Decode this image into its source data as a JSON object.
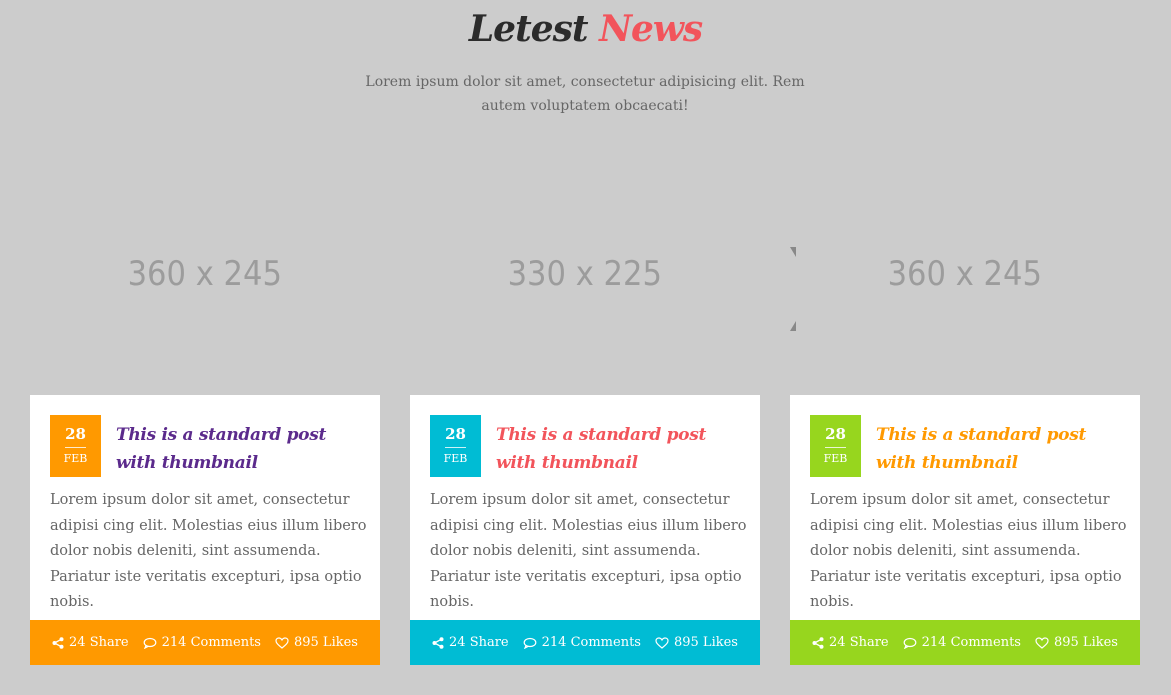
{
  "section": {
    "title_part1": "Letest",
    "title_part2": "News",
    "subtitle": "Lorem ipsum dolor sit amet, consectetur adipisicing elit. Rem autem voluptatem obcaecati!"
  },
  "colors": {
    "background": "#cccccc",
    "title_accent": "#f2545b",
    "card1_accent": "#ff9900",
    "card1_title": "#5b2a8c",
    "card2_accent": "#00bcd4",
    "card2_title": "#f2545b",
    "card3_accent": "#97d61e",
    "card3_title": "#ff9900"
  },
  "icons": {
    "share": "share-icon",
    "comments": "comment-icon",
    "likes": "heart-icon"
  },
  "posts": [
    {
      "thumbnail_label": "360 x 245",
      "day": "28",
      "month": "FEB",
      "title": "This is a standard post with thumbnail",
      "excerpt": "Lorem ipsum dolor sit amet, consectetur adipisi cing elit. Molestias eius illum libero dolor nobis deleniti, sint assumenda. Pariatur iste veritatis excepturi, ipsa optio nobis.",
      "share": "24 Share",
      "comments": "214 Comments",
      "likes": "895 Likes"
    },
    {
      "thumbnail_label": "330 x 225",
      "day": "28",
      "month": "FEB",
      "title": "This is a standard post with thumbnail",
      "excerpt": "Lorem ipsum dolor sit amet, consectetur adipisi cing elit. Molestias eius illum libero dolor nobis deleniti, sint assumenda. Pariatur iste veritatis excepturi, ipsa optio nobis.",
      "share": "24 Share",
      "comments": "214 Comments",
      "likes": "895 Likes"
    },
    {
      "thumbnail_label": "360 x 245",
      "day": "28",
      "month": "FEB",
      "title": "This is a standard post with thumbnail",
      "excerpt": "Lorem ipsum dolor sit amet, consectetur adipisi cing elit. Molestias eius illum libero dolor nobis deleniti, sint assumenda. Pariatur iste veritatis excepturi, ipsa optio nobis.",
      "share": "24 Share",
      "comments": "214 Comments",
      "likes": "895 Likes"
    }
  ]
}
